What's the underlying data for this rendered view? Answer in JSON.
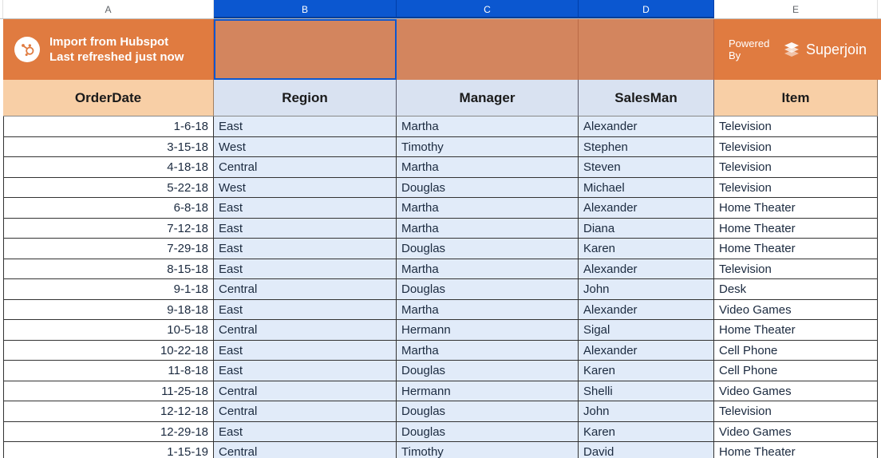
{
  "column_letters": [
    "A",
    "B",
    "C",
    "D",
    "E"
  ],
  "selected_cols": [
    "B",
    "C",
    "D"
  ],
  "banner": {
    "title_line1": "Import from Hubspot",
    "title_line2": "Last refreshed just now",
    "powered_by": "Powered By",
    "superjoin": "Superjoin"
  },
  "headers": {
    "A": "OrderDate",
    "B": "Region",
    "C": "Manager",
    "D": "SalesMan",
    "E": "Item"
  },
  "rows": [
    {
      "A": "1-6-18",
      "B": "East",
      "C": "Martha",
      "D": "Alexander",
      "E": "Television"
    },
    {
      "A": "3-15-18",
      "B": "West",
      "C": "Timothy",
      "D": "Stephen",
      "E": "Television"
    },
    {
      "A": "4-18-18",
      "B": "Central",
      "C": "Martha",
      "D": "Steven",
      "E": "Television"
    },
    {
      "A": "5-22-18",
      "B": "West",
      "C": "Douglas",
      "D": "Michael",
      "E": "Television"
    },
    {
      "A": "6-8-18",
      "B": "East",
      "C": "Martha",
      "D": "Alexander",
      "E": "Home Theater"
    },
    {
      "A": "7-12-18",
      "B": "East",
      "C": "Martha",
      "D": "Diana",
      "E": "Home Theater"
    },
    {
      "A": "7-29-18",
      "B": "East",
      "C": "Douglas",
      "D": "Karen",
      "E": "Home Theater"
    },
    {
      "A": "8-15-18",
      "B": "East",
      "C": "Martha",
      "D": "Alexander",
      "E": "Television"
    },
    {
      "A": "9-1-18",
      "B": "Central",
      "C": "Douglas",
      "D": "John",
      "E": "Desk"
    },
    {
      "A": "9-18-18",
      "B": "East",
      "C": "Martha",
      "D": "Alexander",
      "E": "Video Games"
    },
    {
      "A": "10-5-18",
      "B": "Central",
      "C": "Hermann",
      "D": "Sigal",
      "E": "Home Theater"
    },
    {
      "A": "10-22-18",
      "B": "East",
      "C": "Martha",
      "D": "Alexander",
      "E": "Cell Phone"
    },
    {
      "A": "11-8-18",
      "B": "East",
      "C": "Douglas",
      "D": "Karen",
      "E": "Cell Phone"
    },
    {
      "A": "11-25-18",
      "B": "Central",
      "C": "Hermann",
      "D": "Shelli",
      "E": "Video Games"
    },
    {
      "A": "12-12-18",
      "B": "Central",
      "C": "Douglas",
      "D": "John",
      "E": "Television"
    },
    {
      "A": "12-29-18",
      "B": "East",
      "C": "Douglas",
      "D": "Karen",
      "E": "Video Games"
    },
    {
      "A": "1-15-19",
      "B": "Central",
      "C": "Timothy",
      "D": "David",
      "E": "Home Theater"
    }
  ]
}
